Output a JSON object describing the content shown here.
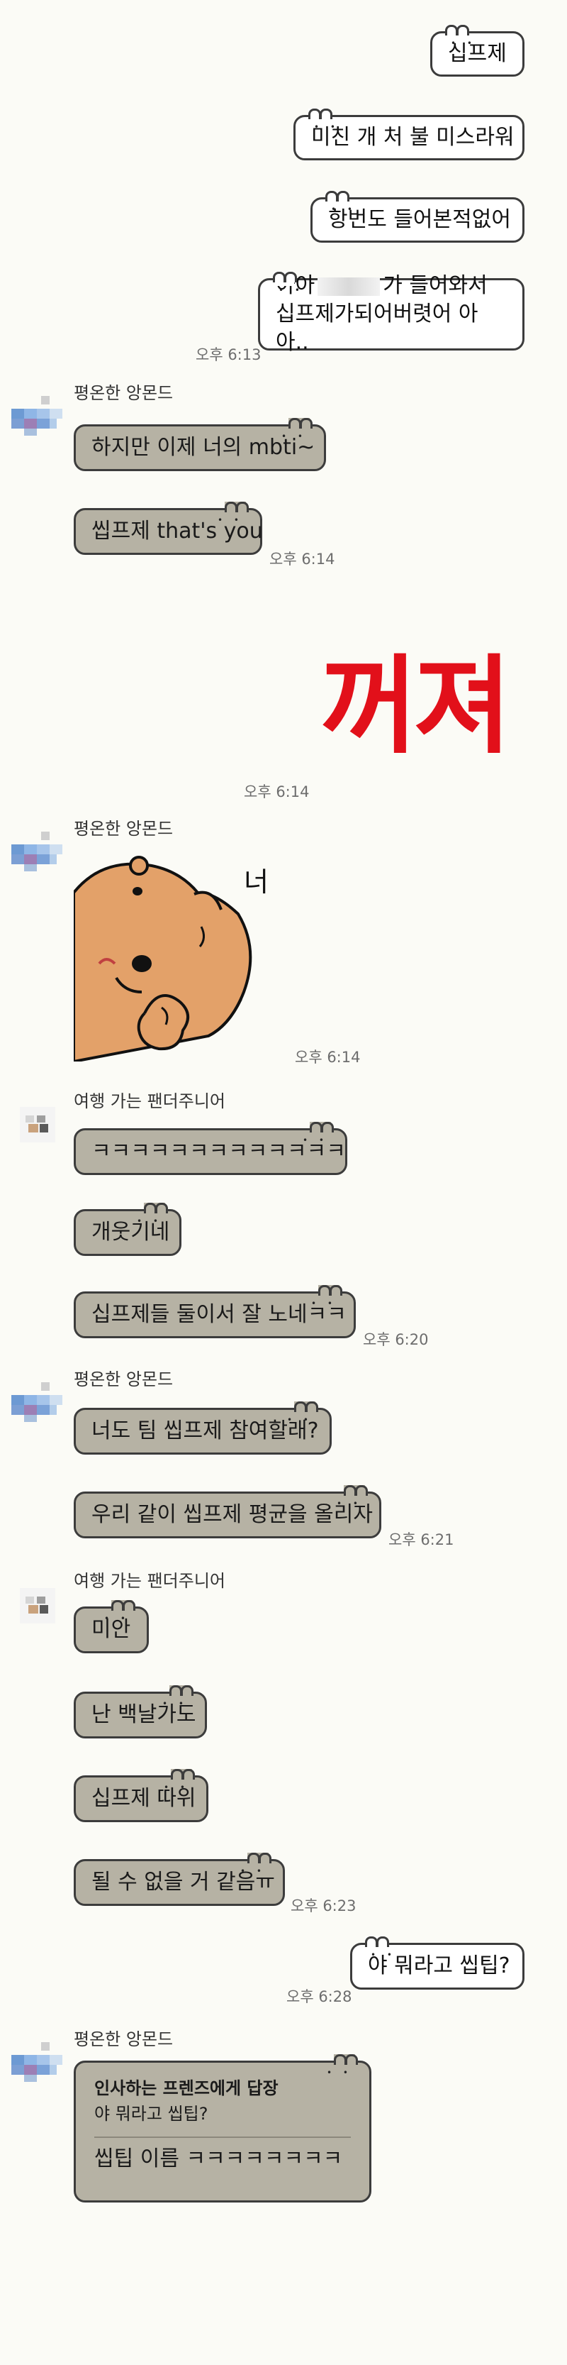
{
  "colors": {
    "background": "#fbfbf6",
    "their_bubble": "#b6b2a4",
    "my_bubble": "#ffffff",
    "shout": "#e2101a"
  },
  "msgs": {
    "m1": "십프제",
    "m2": "미친 개 처 불 미스라워",
    "m3": "항번도 들어본적없어",
    "m4a": "아아",
    "m4a2": "가 들어와서",
    "m4b": "십프제가되어버렷어 아아..",
    "t1": "오후 6:13",
    "name_almond": "평온한 앙몬드",
    "m5": "하지만 이제 너의 mbti~",
    "m6": "씹프제 that's you",
    "t2": "오후 6:14",
    "shout": "꺼져",
    "t3": "오후 6:14",
    "sticker_text": "너",
    "t4": "오후 6:14",
    "name_panda": "여행 가는 팬더주니어",
    "m7": "ㅋㅋㅋㅋㅋㅋㅋㅋㅋㅋㅋㅋㅋ",
    "m8": "개웃기네",
    "m9": "십프제들 둘이서 잘 노네ㅋㅋ",
    "t5": "오후 6:20",
    "m10": "너도 팀 씹프제 참여할래?",
    "m11": "우리 같이 씹프제 평균을 올리자",
    "t6": "오후 6:21",
    "m12": "미안",
    "m13": "난 백날가도",
    "m14": "십프제 따위",
    "m15": "될 수 없을 거 같음ㅠ",
    "t7": "오후 6:23",
    "m16": "야 뭐라고 씹팁?",
    "t8": "오후 6:28",
    "reply_title": "인사하는 프렌즈에게 답장",
    "reply_quote": "야 뭐라고 씹팁?",
    "reply_body": "씹팁 이름 ㅋㅋㅋㅋㅋㅋㅋㅋ"
  }
}
